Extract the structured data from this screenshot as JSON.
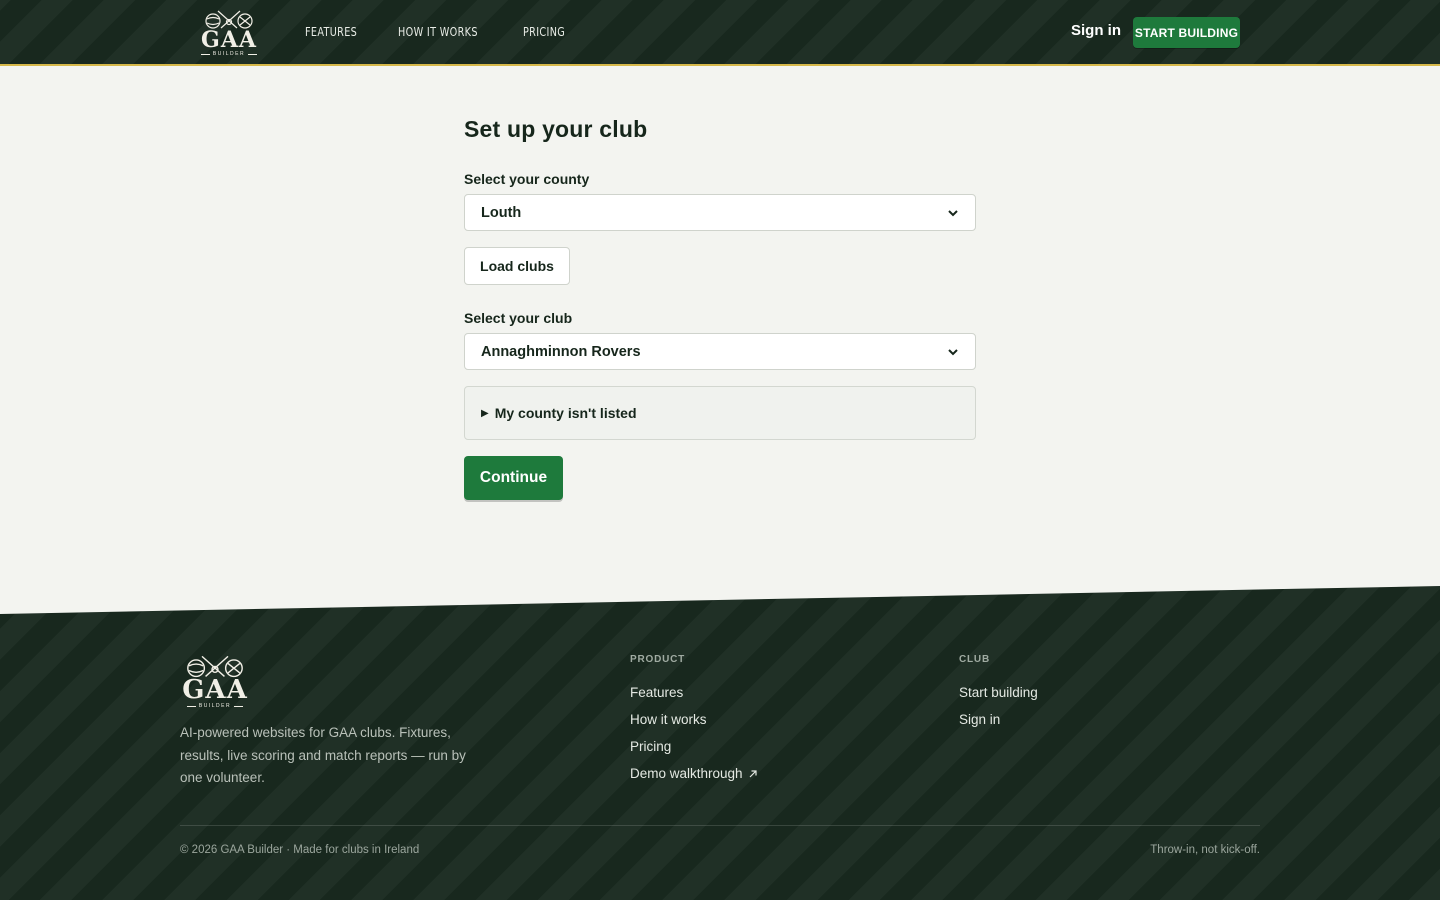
{
  "header": {
    "logo": {
      "word": "GAA",
      "sub": "BUILDER"
    },
    "nav": [
      "FEATURES",
      "HOW IT WORKS",
      "PRICING"
    ],
    "sign_in": "Sign in",
    "cta": "START BUILDING"
  },
  "form": {
    "title": "Set up your club",
    "county_label": "Select your county",
    "county_value": "Louth",
    "load_button": "Load clubs",
    "club_label": "Select your club",
    "club_value": "Annaghminnon Rovers",
    "not_listed": "My county isn't listed",
    "continue": "Continue"
  },
  "footer": {
    "logo": {
      "word": "GAA",
      "sub": "BUILDER"
    },
    "tagline": "AI-powered websites for GAA clubs. Fixtures, results, live scoring and match reports — run by one volunteer.",
    "product": {
      "heading": "PRODUCT",
      "links": [
        "Features",
        "How it works",
        "Pricing",
        "Demo walkthrough"
      ]
    },
    "club": {
      "heading": "CLUB",
      "links": [
        "Start building",
        "Sign in"
      ]
    },
    "copyright": "© 2026 GAA Builder · Made for clubs in Ireland",
    "motto": "Throw-in, not kick-off."
  },
  "colors": {
    "dark_green": "#18281e",
    "accent_green": "#1e7a3c",
    "gold": "#d6b84a",
    "page_bg": "#f3f4f0"
  },
  "icons": [
    "crest-logo-icon",
    "chevron-down-icon",
    "disclosure-triangle-icon",
    "external-arrow-icon"
  ]
}
